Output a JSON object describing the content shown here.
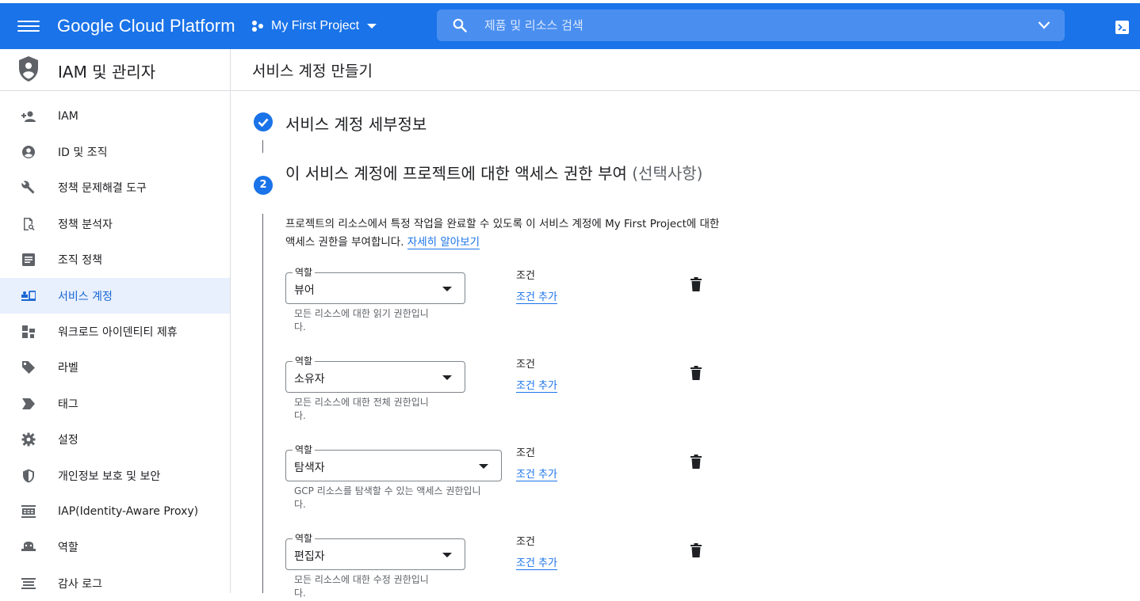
{
  "topbar": {
    "brand": "Google Cloud Platform",
    "project_name": "My First Project",
    "search_placeholder": "제품 및 리소스 검색"
  },
  "sidebar": {
    "title": "IAM 및 관리자",
    "items": [
      {
        "label": "IAM",
        "icon": "person-add-icon"
      },
      {
        "label": "ID 및 조직",
        "icon": "account-circle-icon"
      },
      {
        "label": "정책 문제해결 도구",
        "icon": "wrench-icon"
      },
      {
        "label": "정책 분석자",
        "icon": "document-search-icon"
      },
      {
        "label": "조직 정책",
        "icon": "list-alt-icon"
      },
      {
        "label": "서비스 계정",
        "icon": "service-account-icon",
        "active": true
      },
      {
        "label": "워크로드 아이덴티티 제휴",
        "icon": "workload-icon"
      },
      {
        "label": "라벨",
        "icon": "label-icon"
      },
      {
        "label": "태그",
        "icon": "tag-icon"
      },
      {
        "label": "설정",
        "icon": "gear-icon"
      },
      {
        "label": "개인정보 보호 및 보안",
        "icon": "shield-icon"
      },
      {
        "label": "IAP(Identity-Aware Proxy)",
        "icon": "iap-icon"
      },
      {
        "label": "역할",
        "icon": "roles-icon"
      },
      {
        "label": "감사 로그",
        "icon": "audit-log-icon"
      }
    ]
  },
  "main": {
    "page_title": "서비스 계정 만들기",
    "step1_title": "서비스 계정 세부정보",
    "step2_number": "2",
    "step2_title": "이 서비스 계정에 프로젝트에 대한 액세스 권한 부여",
    "step2_optional": "(선택사항)",
    "description": "프로젝트의 리소스에서 특정 작업을 완료할 수 있도록 이 서비스 계정에 My First Project에 대한 액세스 권한을 부여합니다.",
    "learn_more": "자세히 알아보기",
    "role_field_label": "역할",
    "condition_label": "조건",
    "add_condition": "조건 추가",
    "roles": [
      {
        "value": "뷰어",
        "help": "모든 리소스에 대한 읽기 권한입니다."
      },
      {
        "value": "소유자",
        "help": "모든 리소스에 대한 전체 권한입니다."
      },
      {
        "value": "탐색자",
        "help": "GCP 리소스를 탐색할 수 있는 액세스 권한입니다."
      },
      {
        "value": "편집자",
        "help": "모든 리소스에 대한 수정 권한입니다."
      }
    ]
  },
  "colors": {
    "brand_blue": "#1a73e8",
    "active_bg": "#e8f0fe"
  }
}
